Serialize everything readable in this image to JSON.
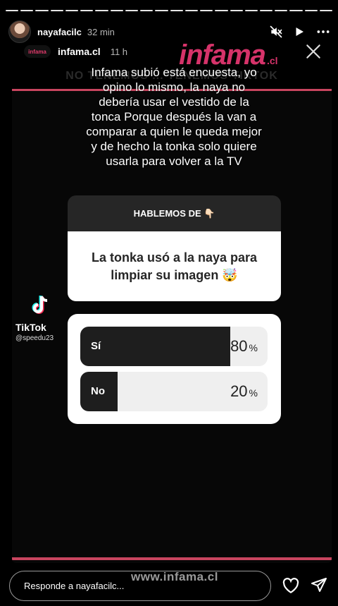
{
  "story": {
    "username": "nayafacilc",
    "time_ago": "32 min",
    "segments": 22,
    "active_segments": 22
  },
  "header_icons": [
    "mute-icon",
    "play-icon",
    "more-icon"
  ],
  "media": {
    "source_account": "infama.cl",
    "source_logo_text": "infama",
    "source_time": "11 h",
    "brand_text": "infama",
    "brand_suffix": ".cl",
    "faded_banner_text": "NO TENEMOS ... TENEMOS TIKTOK",
    "caption": "Infama subió está encuesta, yo opino lo mismo, la naya no debería usar el vestido de la tonca Porque después la van a comparar a quien le queda mejor y de hecho la tonka solo quiere usarla para volver a la TV",
    "question_sticker": {
      "header": "HABLEMOS DE 👇🏻",
      "body": "La tonka usó a la naya para limpiar su imagen 🤯"
    },
    "poll": {
      "options": [
        {
          "label": "Sí",
          "percent": 80,
          "percent_text": "80",
          "percent_sign": "%"
        },
        {
          "label": "No",
          "percent": 20,
          "percent_text": "20",
          "percent_sign": "%"
        }
      ]
    },
    "tiktok": {
      "brand": "TikTok",
      "handle": "@speedu23"
    },
    "watermark": "www.infama.cl"
  },
  "reply": {
    "placeholder": "Responde a nayafacilc..."
  },
  "colors": {
    "accent_pink": "#d6336a",
    "line_pink": "#c9455f",
    "poll_fill": "#1e1e1e",
    "question_header_bg": "#262626"
  }
}
